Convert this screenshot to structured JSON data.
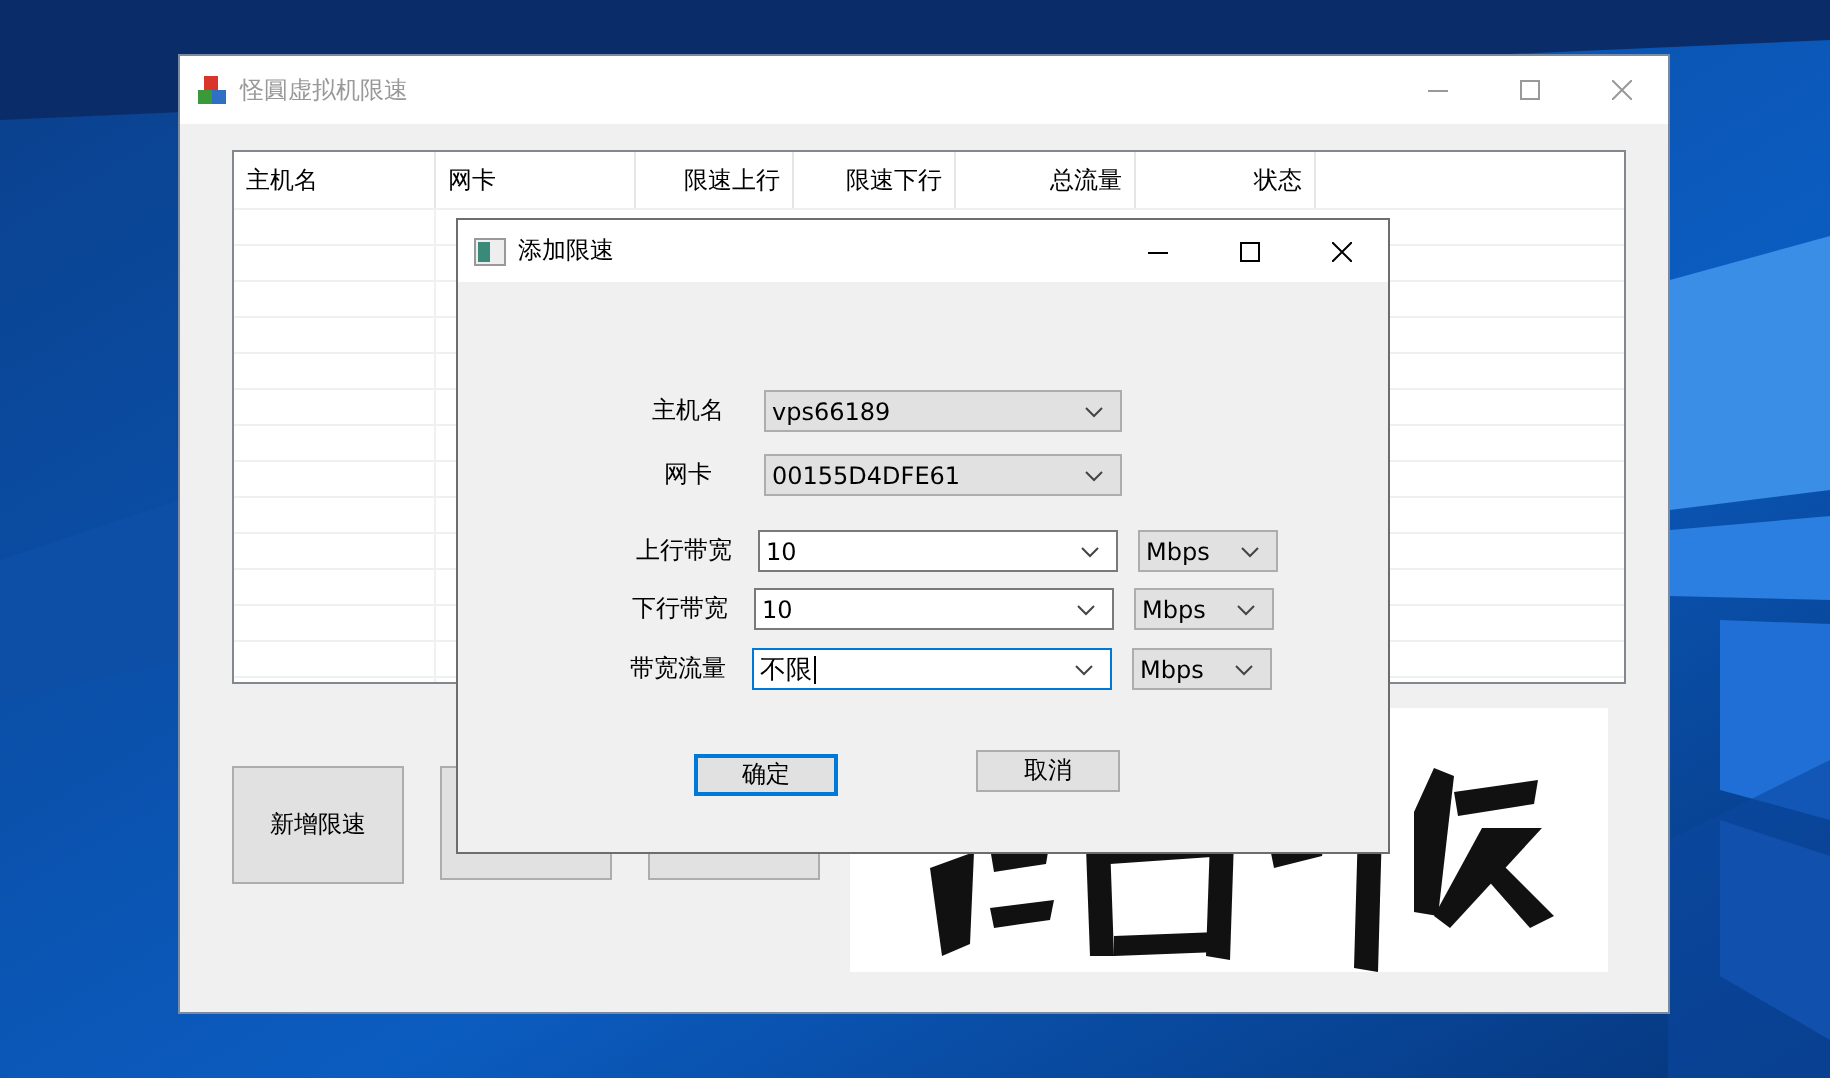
{
  "main_window": {
    "title": "怪圓虚拟机限速",
    "active": false,
    "table": {
      "columns": [
        {
          "label": "主机名"
        },
        {
          "label": "网卡"
        },
        {
          "label": "限速上行"
        },
        {
          "label": "限速下行"
        },
        {
          "label": "总流量"
        },
        {
          "label": "状态"
        }
      ]
    },
    "buttons": [
      {
        "kind": "labeled",
        "label": "新增限速"
      },
      {
        "kind": "covered"
      },
      {
        "kind": "covered"
      }
    ]
  },
  "dialog": {
    "title": "添加限速",
    "active": true,
    "fields": [
      {
        "label": "主机名",
        "value": "vps66189",
        "editable": false,
        "focused": false
      },
      {
        "label": "网卡",
        "value": "00155D4DFE61",
        "editable": false,
        "focused": false
      },
      {
        "label": "上行带宽",
        "value": "10",
        "editable": true,
        "focused": false,
        "unit": "Mbps"
      },
      {
        "label": "下行带宽",
        "value": "10",
        "editable": true,
        "focused": false,
        "unit": "Mbps"
      },
      {
        "label": "带宽流量",
        "value": "不限",
        "editable": true,
        "focused": true,
        "unit": "Mbps"
      }
    ],
    "buttons": [
      {
        "label": "确定",
        "default": true
      },
      {
        "label": "取消",
        "default": false
      }
    ]
  }
}
